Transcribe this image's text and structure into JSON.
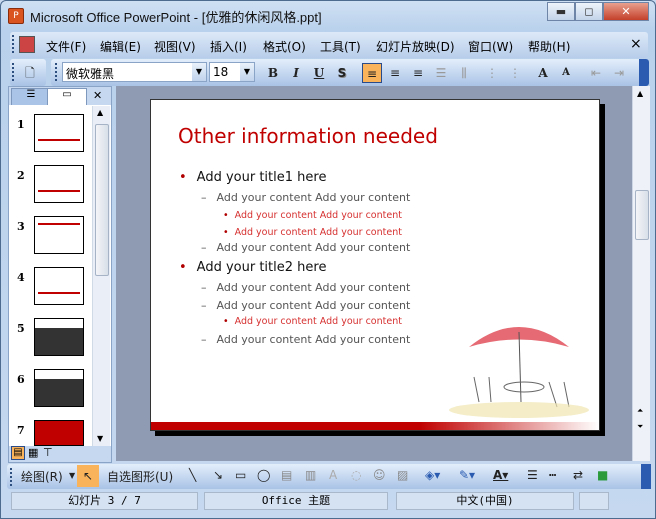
{
  "window": {
    "title": "Microsoft Office PowerPoint - [优雅的休闲风格.ppt]",
    "min": "▬",
    "max": "◻",
    "close": "✕"
  },
  "menu": [
    "文件(F)",
    "编辑(E)",
    "视图(V)",
    "插入(I)",
    "格式(O)",
    "工具(T)",
    "幻灯片放映(D)",
    "窗口(W)",
    "帮助(H)"
  ],
  "menu_close": "×",
  "format": {
    "font": "微软雅黑",
    "size": "18",
    "bold": "B",
    "italic": "I",
    "underline": "U",
    "shadow": "S"
  },
  "slide_numbers": [
    "1",
    "2",
    "3",
    "4",
    "5",
    "6",
    "7"
  ],
  "slide": {
    "title": "Other information needed",
    "items": [
      {
        "level": 1,
        "text": "Add your title1 here"
      },
      {
        "level": 2,
        "text": "Add your content Add your content"
      },
      {
        "level": 3,
        "text": "Add your content Add your content"
      },
      {
        "level": 3,
        "text": "Add your content Add your content"
      },
      {
        "level": 2,
        "text": "Add your content Add your content"
      },
      {
        "level": 1,
        "text": "Add your title2 here"
      },
      {
        "level": 2,
        "text": "Add your content Add your content"
      },
      {
        "level": 2,
        "text": "Add your content Add your content"
      },
      {
        "level": 3,
        "text": "Add your content Add your content"
      },
      {
        "level": 2,
        "text": "Add your content Add your content"
      }
    ]
  },
  "draw": {
    "draw_label": "绘图(R)",
    "autoshape_label": "自选图形(U)"
  },
  "status": {
    "slide": "幻灯片 3 / 7",
    "theme": "Office 主题",
    "lang": "中文(中国)"
  },
  "colors": {
    "accent": "#c00000",
    "highlight": "#f9b35b"
  }
}
